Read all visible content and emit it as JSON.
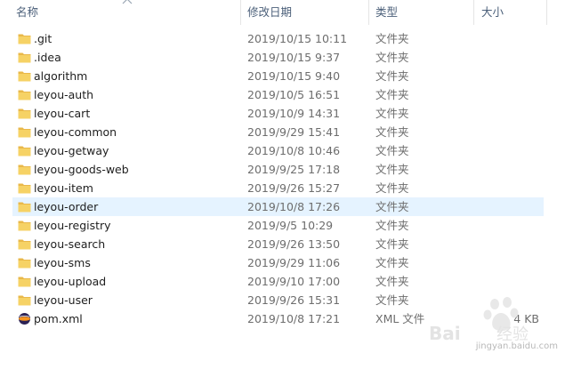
{
  "columns": {
    "name": "名称",
    "date": "修改日期",
    "type": "类型",
    "size": "大小"
  },
  "files": [
    {
      "name": ".git",
      "date": "2019/10/15 10:11",
      "type": "文件夹",
      "size": "",
      "icon": "folder-icon"
    },
    {
      "name": ".idea",
      "date": "2019/10/15 9:37",
      "type": "文件夹",
      "size": "",
      "icon": "folder-icon"
    },
    {
      "name": "algorithm",
      "date": "2019/10/15 9:40",
      "type": "文件夹",
      "size": "",
      "icon": "folder-icon"
    },
    {
      "name": "leyou-auth",
      "date": "2019/10/5 16:51",
      "type": "文件夹",
      "size": "",
      "icon": "folder-icon"
    },
    {
      "name": "leyou-cart",
      "date": "2019/10/9 14:31",
      "type": "文件夹",
      "size": "",
      "icon": "folder-icon"
    },
    {
      "name": "leyou-common",
      "date": "2019/9/29 15:41",
      "type": "文件夹",
      "size": "",
      "icon": "folder-icon"
    },
    {
      "name": "leyou-getway",
      "date": "2019/10/8 10:46",
      "type": "文件夹",
      "size": "",
      "icon": "folder-icon"
    },
    {
      "name": "leyou-goods-web",
      "date": "2019/9/25 17:18",
      "type": "文件夹",
      "size": "",
      "icon": "folder-icon"
    },
    {
      "name": "leyou-item",
      "date": "2019/9/26 15:27",
      "type": "文件夹",
      "size": "",
      "icon": "folder-icon"
    },
    {
      "name": "leyou-order",
      "date": "2019/10/8 17:26",
      "type": "文件夹",
      "size": "",
      "icon": "folder-icon",
      "selected": true
    },
    {
      "name": "leyou-registry",
      "date": "2019/9/5 10:29",
      "type": "文件夹",
      "size": "",
      "icon": "folder-icon"
    },
    {
      "name": "leyou-search",
      "date": "2019/9/26 13:50",
      "type": "文件夹",
      "size": "",
      "icon": "folder-icon"
    },
    {
      "name": "leyou-sms",
      "date": "2019/9/29 11:06",
      "type": "文件夹",
      "size": "",
      "icon": "folder-icon"
    },
    {
      "name": "leyou-upload",
      "date": "2019/9/10 17:00",
      "type": "文件夹",
      "size": "",
      "icon": "folder-icon"
    },
    {
      "name": "leyou-user",
      "date": "2019/9/26 15:31",
      "type": "文件夹",
      "size": "",
      "icon": "folder-icon"
    },
    {
      "name": "pom.xml",
      "date": "2019/10/8 17:21",
      "type": "XML 文件",
      "size": "4 KB",
      "icon": "xml-file-icon"
    }
  ],
  "watermark": {
    "text": "jingyan.baidu.com",
    "logo": "Baidu 经验"
  },
  "colors": {
    "folder": "#f6d265",
    "selected_row": "#e5f3ff",
    "header_text": "#4c607a"
  }
}
